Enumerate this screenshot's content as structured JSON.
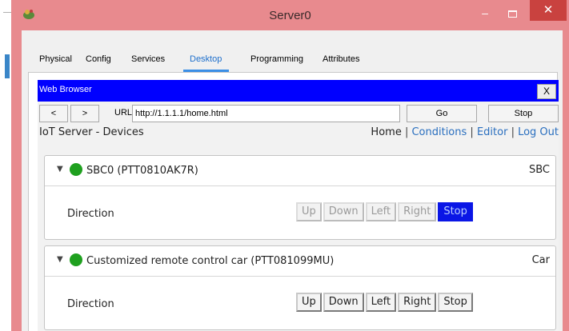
{
  "window": {
    "title": "Server0",
    "minimize_label": "–",
    "close_label": "✕"
  },
  "tabs": [
    {
      "label": "Physical",
      "active": false
    },
    {
      "label": "Config",
      "active": false
    },
    {
      "label": "Services",
      "active": false
    },
    {
      "label": "Desktop",
      "active": true
    },
    {
      "label": "Programming",
      "active": false
    },
    {
      "label": "Attributes",
      "active": false
    }
  ],
  "browser": {
    "title": "Web Browser",
    "close_label": "X",
    "back_label": "<",
    "forward_label": ">",
    "url_label": "URL",
    "url_value": "http://1.1.1.1/home.html",
    "go_label": "Go",
    "stop_label": "Stop"
  },
  "page": {
    "title": "IoT Server - Devices",
    "links": {
      "home": "Home",
      "conditions": "Conditions",
      "editor": "Editor",
      "logout": "Log Out",
      "separator": "|"
    }
  },
  "devices": [
    {
      "name": "SBC0 (PTT0810AK7R)",
      "type": "SBC",
      "status_color": "#1fa01f",
      "control_label": "Direction",
      "buttons": [
        "Up",
        "Down",
        "Left",
        "Right",
        "Stop"
      ],
      "active_button": "Stop",
      "enabled": false
    },
    {
      "name": "Customized remote control car (PTT081099MU)",
      "type": "Car",
      "status_color": "#1fa01f",
      "control_label": "Direction",
      "buttons": [
        "Up",
        "Down",
        "Left",
        "Right",
        "Stop"
      ],
      "enabled": true
    }
  ],
  "colors": {
    "titlebar": "#e88a8e",
    "close_button": "#c9423f",
    "browser_header": "#0000ff",
    "active_tab": "#1e6fcc",
    "link": "#2a6fbf",
    "active_control": "#0a16e6"
  }
}
